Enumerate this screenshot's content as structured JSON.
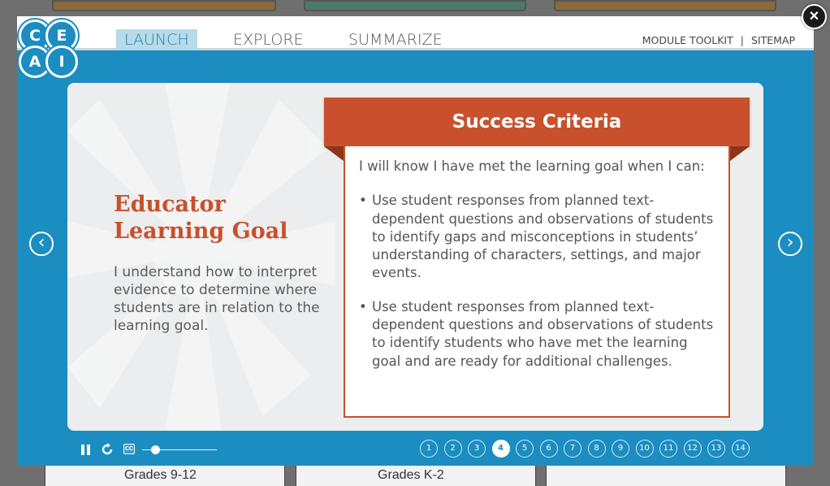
{
  "background": {
    "grade_labels": [
      "Grades 9-12",
      "Grades K-2"
    ]
  },
  "logo": {
    "letters": [
      "C",
      "E",
      "A",
      "I"
    ]
  },
  "nav": {
    "tabs": [
      {
        "label": "LAUNCH",
        "active": true
      },
      {
        "label": "EXPLORE",
        "active": false
      },
      {
        "label": "SUMMARIZE",
        "active": false
      }
    ],
    "links": [
      "MODULE TOOLKIT",
      "SITEMAP"
    ],
    "separator": "|"
  },
  "close_button": {
    "glyph": "×"
  },
  "slide": {
    "goal_title": "Educator Learning Goal",
    "goal_text": "I understand how to interpret evidence to determine where students are in relation to the learning goal.",
    "criteria_title": "Success Criteria",
    "criteria_intro": "I will know I have met the learning goal when I can:",
    "criteria": [
      "Use student responses from planned text-dependent questions and observations of students to identify gaps and misconceptions in students’ understanding of characters, settings, and major events.",
      "Use student responses from planned text-dependent questions and observations of students to identify students who have met the learning goal and are ready for additional challenges."
    ]
  },
  "controls": {
    "cc_label": "CC",
    "progress": 0.18
  },
  "pager": {
    "pages": [
      "1",
      "2",
      "3",
      "4",
      "5",
      "6",
      "7",
      "8",
      "9",
      "10",
      "11",
      "12",
      "13",
      "14"
    ],
    "current": "4"
  },
  "colors": {
    "accent_blue": "#1b8dc1",
    "accent_orange": "#c9502c"
  }
}
